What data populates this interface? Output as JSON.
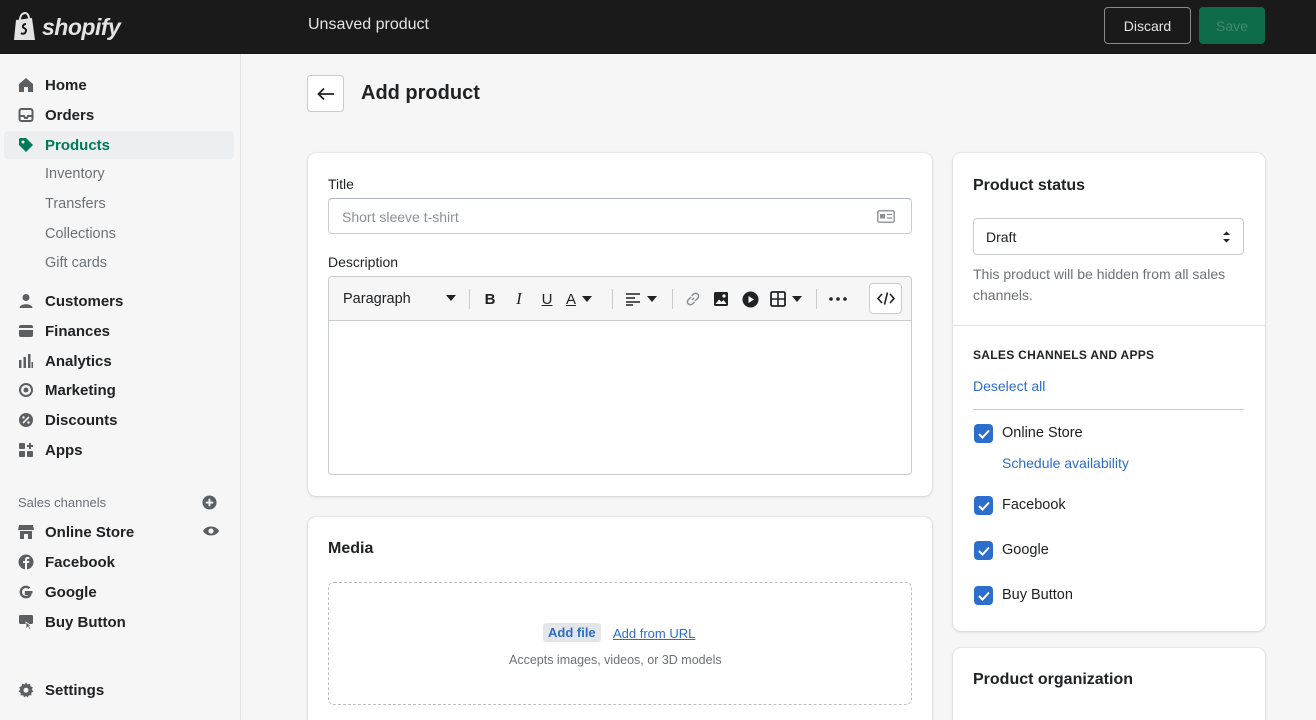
{
  "app": {
    "brand": "shopify",
    "window_title": "Unsaved product",
    "discard_label": "Discard",
    "save_label": "Save"
  },
  "sidebar": {
    "items": [
      {
        "label": "Home",
        "icon": "home-icon"
      },
      {
        "label": "Orders",
        "icon": "orders-icon"
      },
      {
        "label": "Products",
        "icon": "tag-icon",
        "active": true
      },
      {
        "label": "Inventory"
      },
      {
        "label": "Transfers"
      },
      {
        "label": "Collections"
      },
      {
        "label": "Gift cards"
      },
      {
        "label": "Customers",
        "icon": "person-icon"
      },
      {
        "label": "Finances",
        "icon": "finances-icon"
      },
      {
        "label": "Analytics",
        "icon": "bar-chart-icon"
      },
      {
        "label": "Marketing",
        "icon": "target-icon"
      },
      {
        "label": "Discounts",
        "icon": "discount-icon"
      },
      {
        "label": "Apps",
        "icon": "apps-icon"
      }
    ],
    "sales_channels_label": "Sales channels",
    "channels": [
      {
        "label": "Online Store",
        "icon": "store-icon"
      },
      {
        "label": "Facebook",
        "icon": "facebook-icon"
      },
      {
        "label": "Google",
        "icon": "google-icon"
      },
      {
        "label": "Buy Button",
        "icon": "buy-button-icon"
      }
    ],
    "settings_label": "Settings"
  },
  "page": {
    "title": "Add product"
  },
  "form": {
    "title_label": "Title",
    "title_placeholder": "Short sleeve t-shirt",
    "description_label": "Description",
    "toolbar": {
      "format_label": "Paragraph"
    }
  },
  "media": {
    "title": "Media",
    "add_file": "Add file",
    "add_from_url": "Add from URL",
    "hint": "Accepts images, videos, or 3D models"
  },
  "status": {
    "title": "Product status",
    "selected": "Draft",
    "help": "This product will be hidden from all sales channels."
  },
  "sales_channels": {
    "heading": "SALES CHANNELS AND APPS",
    "deselect_all": "Deselect all",
    "channels": [
      {
        "label": "Online Store",
        "checked": true
      },
      {
        "label": "Facebook",
        "checked": true
      },
      {
        "label": "Google",
        "checked": true
      },
      {
        "label": "Buy Button",
        "checked": true
      }
    ],
    "schedule_label": "Schedule availability"
  },
  "organization": {
    "title": "Product organization"
  },
  "colors": {
    "accent_green": "#007a5a",
    "link_blue": "#2c6ecb",
    "topbar": "#1a1a1a"
  }
}
